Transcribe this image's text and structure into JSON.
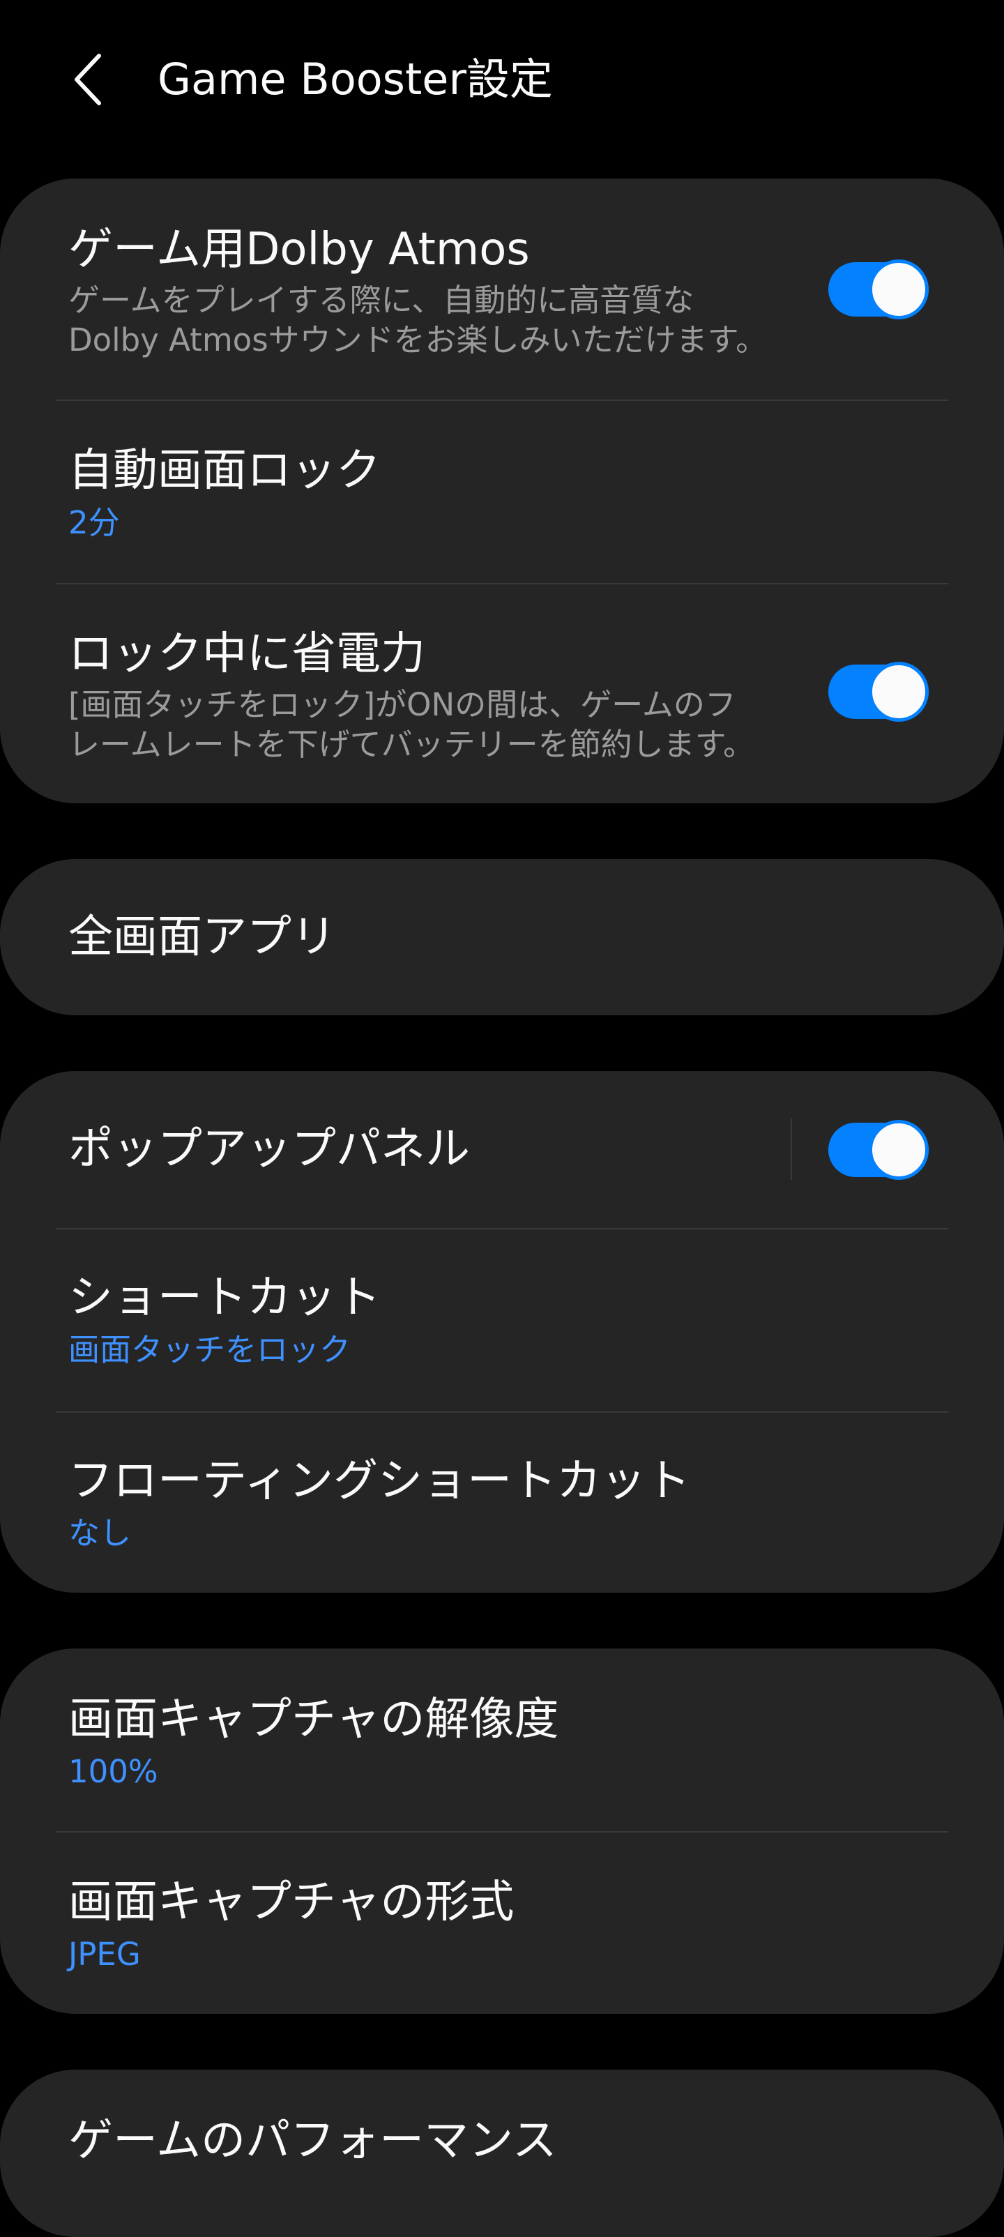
{
  "header": {
    "back_icon": "chevron-left-icon",
    "title": "Game Booster設定"
  },
  "colors": {
    "background": "#000000",
    "card": "#252525",
    "accent": "#0381fe",
    "value_text": "#3e91ff",
    "secondary_text": "#9b9b9b"
  },
  "cards": {
    "sound": {
      "dolby": {
        "title": "ゲーム用Dolby Atmos",
        "desc_line1": "ゲームをプレイする際に、自動的に高音質な",
        "desc_line2": "Dolby Atmosサウンドをお楽しみいただけます。",
        "toggle_on": true
      },
      "auto_lock": {
        "title": "自動画面ロック",
        "value": "2分"
      },
      "power_saving": {
        "title": "ロック中に省電力",
        "desc_line1": "[画面タッチをロック]がONの間は、ゲームのフ",
        "desc_line2": "レームレートを下げてバッテリーを節約します。",
        "toggle_on": true
      }
    },
    "fullscreen": {
      "title": "全画面アプリ"
    },
    "panel": {
      "popup": {
        "title": "ポップアップパネル",
        "toggle_on": true
      },
      "shortcut": {
        "title": "ショートカット",
        "value": "画面タッチをロック"
      },
      "floating": {
        "title": "フローティングショートカット",
        "value": "なし"
      }
    },
    "capture": {
      "resolution": {
        "title": "画面キャプチャの解像度",
        "value": "100%"
      },
      "format": {
        "title": "画面キャプチャの形式",
        "value": "JPEG"
      }
    },
    "performance": {
      "title": "ゲームのパフォーマンス"
    }
  }
}
